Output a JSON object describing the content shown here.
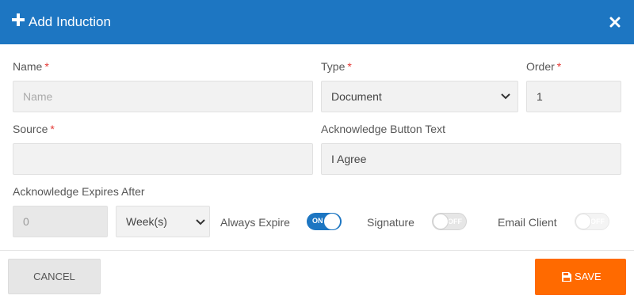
{
  "dialog": {
    "title": "Add Induction",
    "close_icon": "close-icon",
    "add_icon": "plus-icon",
    "accent": "#1d76c2"
  },
  "form": {
    "name": {
      "label": "Name",
      "required_mark": "*",
      "value": "",
      "placeholder": "Name"
    },
    "type": {
      "label": "Type",
      "required_mark": "*",
      "value": "Document",
      "options": [
        "Document"
      ]
    },
    "order": {
      "label": "Order",
      "required_mark": "*",
      "value": "1"
    },
    "source": {
      "label": "Source",
      "required_mark": "*",
      "value": ""
    },
    "ack_button_text": {
      "label": "Acknowledge Button Text",
      "value": "I Agree"
    },
    "ack_expires": {
      "label": "Acknowledge Expires After",
      "value": "0",
      "unit": "Week(s)"
    },
    "always_expire": {
      "label": "Always Expire",
      "state": "ON",
      "on": true
    },
    "signature": {
      "label": "Signature",
      "state": "OFF",
      "on": false
    },
    "email_client": {
      "label": "Email Client",
      "state": "OFF",
      "on": false
    }
  },
  "footer": {
    "cancel_label": "CANCEL",
    "save_label": "SAVE",
    "save_icon": "floppy-disk-icon",
    "save_color": "#ff6a00"
  }
}
